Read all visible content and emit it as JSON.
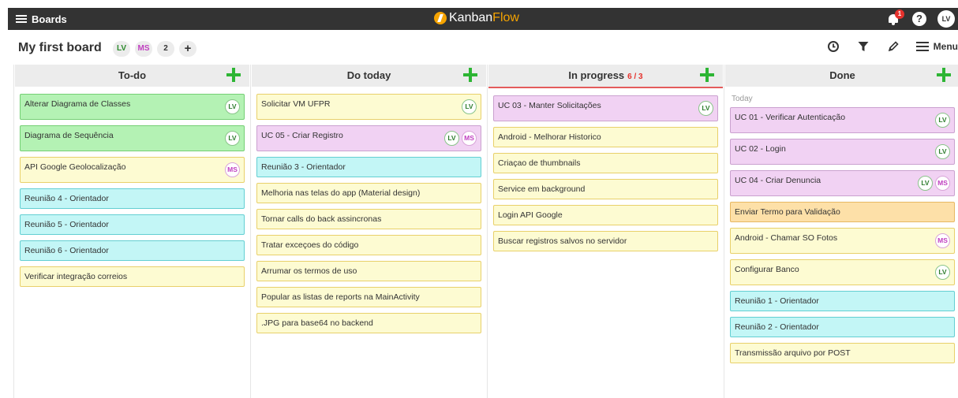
{
  "topbar": {
    "boards_label": "Boards",
    "logo_kanban": "Kanban",
    "logo_flow": "Flow",
    "notification_count": "1",
    "help_label": "?",
    "user_initials": "LV"
  },
  "board": {
    "title": "My first board",
    "members": [
      "LV",
      "MS"
    ],
    "member_count": "2",
    "add_label": "+",
    "menu_label": "Menu"
  },
  "icons": [
    "hamburger-icon",
    "kanbanflow-logo-icon",
    "bell-icon",
    "help-icon",
    "plus-icon",
    "clock-icon",
    "filter-icon",
    "pencil-icon",
    "menu-icon"
  ],
  "colors": {
    "green": "#b4f2b4",
    "yellow": "#fdfbd2",
    "cyan": "#c3f6f6",
    "purple": "#f1d2f3",
    "orange": "#fde0a8",
    "add": "#2db534",
    "wip": "#e5322d"
  },
  "columns": [
    {
      "name": "To-do",
      "tasks": [
        {
          "title": "Alterar Diagrama de Classes",
          "color": "green",
          "assignees": [
            "LV"
          ]
        },
        {
          "title": "Diagrama de Sequência",
          "color": "green",
          "assignees": [
            "LV"
          ]
        },
        {
          "title": "API Google Geolocalização",
          "color": "yellow",
          "assignees": [
            "MS"
          ]
        },
        {
          "title": "Reunião 4 - Orientador",
          "color": "cyan",
          "assignees": []
        },
        {
          "title": "Reunião 5 - Orientador",
          "color": "cyan",
          "assignees": []
        },
        {
          "title": "Reunião 6 - Orientador",
          "color": "cyan",
          "assignees": []
        },
        {
          "title": "Verificar integração correios",
          "color": "yellow",
          "assignees": []
        }
      ]
    },
    {
      "name": "Do today",
      "tasks": [
        {
          "title": "Solicitar VM UFPR",
          "color": "yellow",
          "assignees": [
            "LV"
          ]
        },
        {
          "title": "UC 05 - Criar Registro",
          "color": "purple",
          "assignees": [
            "LV",
            "MS"
          ]
        },
        {
          "title": "Reunião 3 - Orientador",
          "color": "cyan",
          "assignees": []
        },
        {
          "title": "Melhoria nas telas do app (Material design)",
          "color": "yellow",
          "assignees": []
        },
        {
          "title": "Tornar calls do back assincronas",
          "color": "yellow",
          "assignees": []
        },
        {
          "title": "Tratar exceçoes do código",
          "color": "yellow",
          "assignees": []
        },
        {
          "title": "Arrumar os termos de uso",
          "color": "yellow",
          "assignees": []
        },
        {
          "title": "Popular as listas de reports na MainActivity",
          "color": "yellow",
          "assignees": []
        },
        {
          "title": ".JPG para base64 no backend",
          "color": "yellow",
          "assignees": []
        }
      ]
    },
    {
      "name": "In progress",
      "wip": "6 / 3",
      "tasks": [
        {
          "title": "UC 03 - Manter Solicitações",
          "color": "purple",
          "assignees": [
            "LV"
          ]
        },
        {
          "title": "Android - Melhorar Historico",
          "color": "yellow",
          "assignees": []
        },
        {
          "title": "Criaçao de thumbnails",
          "color": "yellow",
          "assignees": []
        },
        {
          "title": "Service em background",
          "color": "yellow",
          "assignees": []
        },
        {
          "title": "Login API Google",
          "color": "yellow",
          "assignees": []
        },
        {
          "title": "Buscar registros salvos no servidor",
          "color": "yellow",
          "assignees": []
        }
      ]
    },
    {
      "name": "Done",
      "group_label": "Today",
      "tasks": [
        {
          "title": "UC 01 - Verificar Autenticação",
          "color": "purple",
          "assignees": [
            "LV"
          ]
        },
        {
          "title": "UC 02 - Login",
          "color": "purple",
          "assignees": [
            "LV"
          ]
        },
        {
          "title": "UC 04 - Criar Denuncia",
          "color": "purple",
          "assignees": [
            "LV",
            "MS"
          ]
        },
        {
          "title": "Enviar Termo para Validação",
          "color": "orange",
          "assignees": []
        },
        {
          "title": "Android - Chamar SO Fotos",
          "color": "yellow",
          "assignees": [
            "MS"
          ]
        },
        {
          "title": "Configurar Banco",
          "color": "yellow",
          "assignees": [
            "LV"
          ]
        },
        {
          "title": "Reunião 1 - Orientador",
          "color": "cyan",
          "assignees": []
        },
        {
          "title": "Reunião 2 - Orientador",
          "color": "cyan",
          "assignees": []
        },
        {
          "title": "Transmissão arquivo por POST",
          "color": "yellow",
          "assignees": []
        }
      ]
    }
  ]
}
